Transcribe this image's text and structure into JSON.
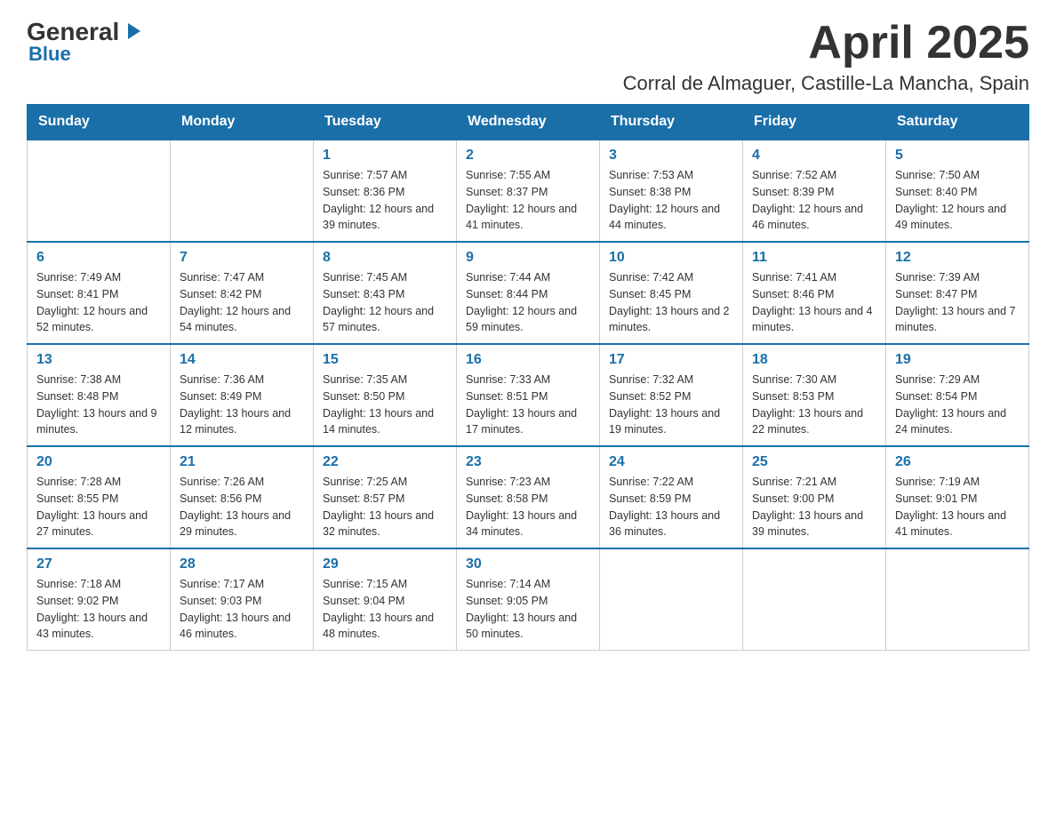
{
  "header": {
    "logo_general": "General",
    "logo_blue": "Blue",
    "title": "April 2025",
    "subtitle": "Corral de Almaguer, Castille-La Mancha, Spain"
  },
  "days_of_week": [
    "Sunday",
    "Monday",
    "Tuesday",
    "Wednesday",
    "Thursday",
    "Friday",
    "Saturday"
  ],
  "weeks": [
    [
      {
        "day": "",
        "sunrise": "",
        "sunset": "",
        "daylight": ""
      },
      {
        "day": "",
        "sunrise": "",
        "sunset": "",
        "daylight": ""
      },
      {
        "day": "1",
        "sunrise": "Sunrise: 7:57 AM",
        "sunset": "Sunset: 8:36 PM",
        "daylight": "Daylight: 12 hours and 39 minutes."
      },
      {
        "day": "2",
        "sunrise": "Sunrise: 7:55 AM",
        "sunset": "Sunset: 8:37 PM",
        "daylight": "Daylight: 12 hours and 41 minutes."
      },
      {
        "day": "3",
        "sunrise": "Sunrise: 7:53 AM",
        "sunset": "Sunset: 8:38 PM",
        "daylight": "Daylight: 12 hours and 44 minutes."
      },
      {
        "day": "4",
        "sunrise": "Sunrise: 7:52 AM",
        "sunset": "Sunset: 8:39 PM",
        "daylight": "Daylight: 12 hours and 46 minutes."
      },
      {
        "day": "5",
        "sunrise": "Sunrise: 7:50 AM",
        "sunset": "Sunset: 8:40 PM",
        "daylight": "Daylight: 12 hours and 49 minutes."
      }
    ],
    [
      {
        "day": "6",
        "sunrise": "Sunrise: 7:49 AM",
        "sunset": "Sunset: 8:41 PM",
        "daylight": "Daylight: 12 hours and 52 minutes."
      },
      {
        "day": "7",
        "sunrise": "Sunrise: 7:47 AM",
        "sunset": "Sunset: 8:42 PM",
        "daylight": "Daylight: 12 hours and 54 minutes."
      },
      {
        "day": "8",
        "sunrise": "Sunrise: 7:45 AM",
        "sunset": "Sunset: 8:43 PM",
        "daylight": "Daylight: 12 hours and 57 minutes."
      },
      {
        "day": "9",
        "sunrise": "Sunrise: 7:44 AM",
        "sunset": "Sunset: 8:44 PM",
        "daylight": "Daylight: 12 hours and 59 minutes."
      },
      {
        "day": "10",
        "sunrise": "Sunrise: 7:42 AM",
        "sunset": "Sunset: 8:45 PM",
        "daylight": "Daylight: 13 hours and 2 minutes."
      },
      {
        "day": "11",
        "sunrise": "Sunrise: 7:41 AM",
        "sunset": "Sunset: 8:46 PM",
        "daylight": "Daylight: 13 hours and 4 minutes."
      },
      {
        "day": "12",
        "sunrise": "Sunrise: 7:39 AM",
        "sunset": "Sunset: 8:47 PM",
        "daylight": "Daylight: 13 hours and 7 minutes."
      }
    ],
    [
      {
        "day": "13",
        "sunrise": "Sunrise: 7:38 AM",
        "sunset": "Sunset: 8:48 PM",
        "daylight": "Daylight: 13 hours and 9 minutes."
      },
      {
        "day": "14",
        "sunrise": "Sunrise: 7:36 AM",
        "sunset": "Sunset: 8:49 PM",
        "daylight": "Daylight: 13 hours and 12 minutes."
      },
      {
        "day": "15",
        "sunrise": "Sunrise: 7:35 AM",
        "sunset": "Sunset: 8:50 PM",
        "daylight": "Daylight: 13 hours and 14 minutes."
      },
      {
        "day": "16",
        "sunrise": "Sunrise: 7:33 AM",
        "sunset": "Sunset: 8:51 PM",
        "daylight": "Daylight: 13 hours and 17 minutes."
      },
      {
        "day": "17",
        "sunrise": "Sunrise: 7:32 AM",
        "sunset": "Sunset: 8:52 PM",
        "daylight": "Daylight: 13 hours and 19 minutes."
      },
      {
        "day": "18",
        "sunrise": "Sunrise: 7:30 AM",
        "sunset": "Sunset: 8:53 PM",
        "daylight": "Daylight: 13 hours and 22 minutes."
      },
      {
        "day": "19",
        "sunrise": "Sunrise: 7:29 AM",
        "sunset": "Sunset: 8:54 PM",
        "daylight": "Daylight: 13 hours and 24 minutes."
      }
    ],
    [
      {
        "day": "20",
        "sunrise": "Sunrise: 7:28 AM",
        "sunset": "Sunset: 8:55 PM",
        "daylight": "Daylight: 13 hours and 27 minutes."
      },
      {
        "day": "21",
        "sunrise": "Sunrise: 7:26 AM",
        "sunset": "Sunset: 8:56 PM",
        "daylight": "Daylight: 13 hours and 29 minutes."
      },
      {
        "day": "22",
        "sunrise": "Sunrise: 7:25 AM",
        "sunset": "Sunset: 8:57 PM",
        "daylight": "Daylight: 13 hours and 32 minutes."
      },
      {
        "day": "23",
        "sunrise": "Sunrise: 7:23 AM",
        "sunset": "Sunset: 8:58 PM",
        "daylight": "Daylight: 13 hours and 34 minutes."
      },
      {
        "day": "24",
        "sunrise": "Sunrise: 7:22 AM",
        "sunset": "Sunset: 8:59 PM",
        "daylight": "Daylight: 13 hours and 36 minutes."
      },
      {
        "day": "25",
        "sunrise": "Sunrise: 7:21 AM",
        "sunset": "Sunset: 9:00 PM",
        "daylight": "Daylight: 13 hours and 39 minutes."
      },
      {
        "day": "26",
        "sunrise": "Sunrise: 7:19 AM",
        "sunset": "Sunset: 9:01 PM",
        "daylight": "Daylight: 13 hours and 41 minutes."
      }
    ],
    [
      {
        "day": "27",
        "sunrise": "Sunrise: 7:18 AM",
        "sunset": "Sunset: 9:02 PM",
        "daylight": "Daylight: 13 hours and 43 minutes."
      },
      {
        "day": "28",
        "sunrise": "Sunrise: 7:17 AM",
        "sunset": "Sunset: 9:03 PM",
        "daylight": "Daylight: 13 hours and 46 minutes."
      },
      {
        "day": "29",
        "sunrise": "Sunrise: 7:15 AM",
        "sunset": "Sunset: 9:04 PM",
        "daylight": "Daylight: 13 hours and 48 minutes."
      },
      {
        "day": "30",
        "sunrise": "Sunrise: 7:14 AM",
        "sunset": "Sunset: 9:05 PM",
        "daylight": "Daylight: 13 hours and 50 minutes."
      },
      {
        "day": "",
        "sunrise": "",
        "sunset": "",
        "daylight": ""
      },
      {
        "day": "",
        "sunrise": "",
        "sunset": "",
        "daylight": ""
      },
      {
        "day": "",
        "sunrise": "",
        "sunset": "",
        "daylight": ""
      }
    ]
  ]
}
